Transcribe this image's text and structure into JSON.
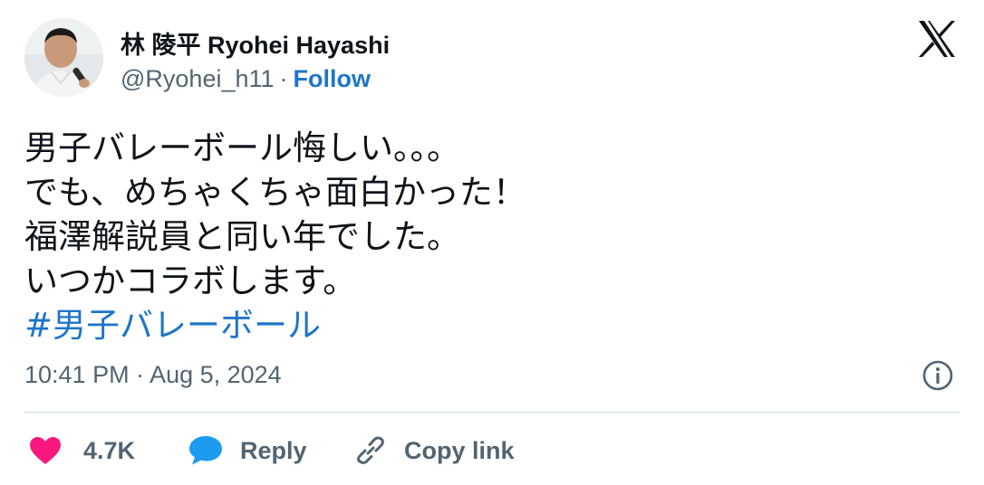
{
  "author": {
    "display_name": "林 陵平 Ryohei Hayashi",
    "handle": "@Ryohei_h11",
    "separator": "·",
    "follow_label": "Follow"
  },
  "tweet": {
    "lines": [
      "男子バレーボール悔しい。。。",
      "でも、めちゃくちゃ面白かった！",
      "福澤解説員と同い年でした。",
      "いつかコラボします。"
    ],
    "hashtag": "#男子バレーボール",
    "timestamp": "10:41 PM · Aug 5, 2024"
  },
  "actions": {
    "like_count": "4.7K",
    "reply_label": "Reply",
    "copy_link_label": "Copy link"
  },
  "icons": {
    "brand": "x-logo-icon",
    "info": "info-icon",
    "like": "heart-icon",
    "reply": "speech-bubble-icon",
    "copy": "link-icon"
  },
  "colors": {
    "link": "#1d76c8",
    "muted": "#536471",
    "heart": "#f91880",
    "reply_bubble": "#1d9bf0",
    "divider": "#cfd9de"
  }
}
